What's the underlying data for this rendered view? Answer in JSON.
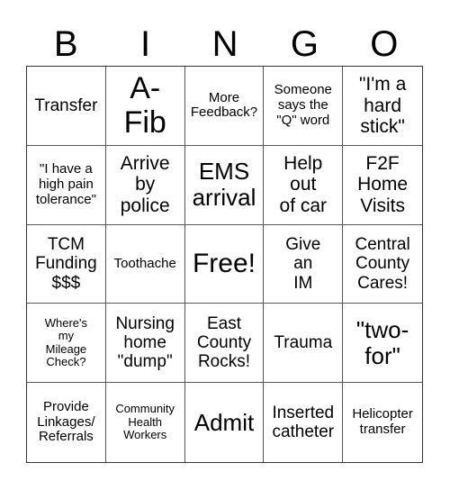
{
  "header": [
    "B",
    "I",
    "N",
    "G",
    "O"
  ],
  "cells": [
    "Transfer",
    "A-\nFib",
    "More\nFeedback?",
    "Someone\nsays the\n\"Q\" word",
    "\"I'm a\nhard\nstick\"",
    "\"I have a\nhigh pain\ntolerance\"",
    "Arrive\nby\npolice",
    "EMS\narrival",
    "Help\nout\nof car",
    "F2F\nHome\nVisits",
    "TCM\nFunding\n$$$",
    "Toothache",
    "Free!",
    "Give\nan\nIM",
    "Central\nCounty\nCares!",
    "Where's\nmy\nMileage\nCheck?",
    "Nursing\nhome\n\"dump\"",
    "East\nCounty\nRocks!",
    "Trauma",
    "\"two-\nfor\"",
    "Provide\nLinkages/\nReferrals",
    "Community\nHealth\nWorkers",
    "Admit",
    "Inserted\ncatheter",
    "Helicopter\ntransfer"
  ]
}
